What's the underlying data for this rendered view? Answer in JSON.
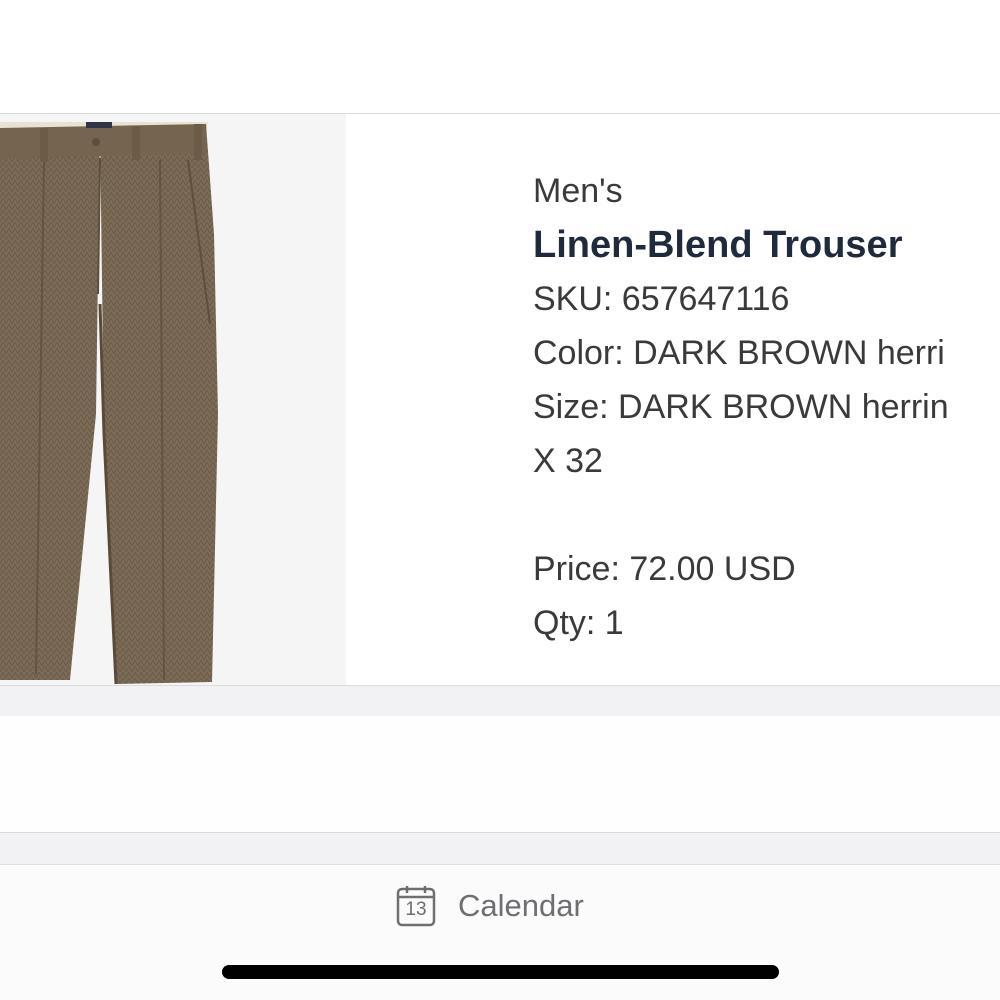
{
  "product": {
    "image_icon": "trousers-photo",
    "category": "Men's",
    "name": "Linen-Blend Trouser",
    "sku": "SKU: 657647116",
    "color": "Color: DARK BROWN herri",
    "size": "Size: DARK BROWN herrin",
    "size_cont": "X 32",
    "price": "Price: 72.00 USD",
    "qty": "Qty: 1"
  },
  "bottom_bar": {
    "calendar_icon": "calendar-icon",
    "calendar_day": "13",
    "calendar_label": "Calendar"
  },
  "colors": {
    "title": "#1f2a3d",
    "text": "#3a3a3c",
    "muted": "#6e6e73",
    "fabric": "#7a6a55"
  }
}
